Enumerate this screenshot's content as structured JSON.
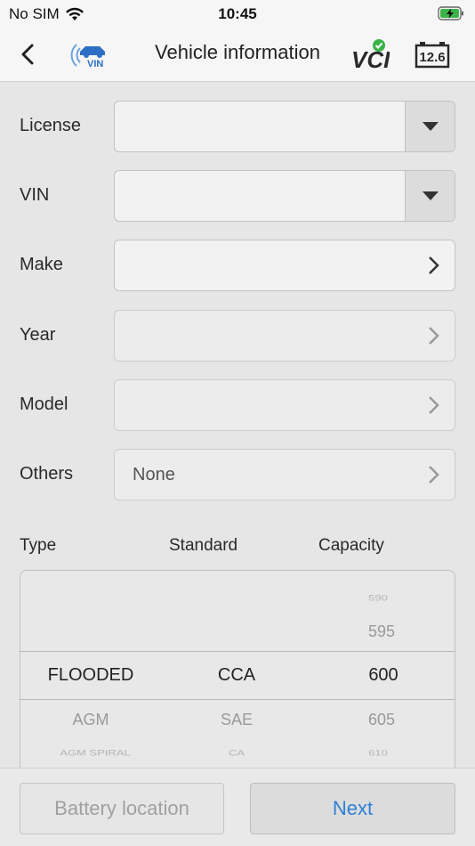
{
  "status_bar": {
    "carrier": "No SIM",
    "time": "10:45",
    "icons": [
      "wifi-icon",
      "battery-charging-icon"
    ]
  },
  "nav": {
    "title": "Vehicle information",
    "vin_logo_text": "VIN",
    "vci_text": "VCI",
    "voltage": "12.6",
    "icons": [
      "back-icon",
      "vin-scan-icon",
      "vci-connected-icon",
      "battery-voltage-icon"
    ]
  },
  "form": {
    "license": {
      "label": "License",
      "value": ""
    },
    "vin": {
      "label": "VIN",
      "value": ""
    },
    "make": {
      "label": "Make",
      "value": ""
    },
    "year": {
      "label": "Year",
      "value": ""
    },
    "model": {
      "label": "Model",
      "value": ""
    },
    "others": {
      "label": "Others",
      "value": "None"
    }
  },
  "picker": {
    "headers": {
      "type": "Type",
      "standard": "Standard",
      "capacity": "Capacity"
    },
    "type_options": [
      "FLOODED",
      "AGM",
      "AGM SPIRAL"
    ],
    "standard_options": [
      "CCA",
      "SAE",
      "CA"
    ],
    "capacity_options": [
      "590",
      "595",
      "600",
      "605",
      "610"
    ],
    "selected": {
      "type": "FLOODED",
      "standard": "CCA",
      "capacity": "600"
    }
  },
  "buttons": {
    "battery_location": "Battery location",
    "next": "Next"
  },
  "colors": {
    "accent": "#2f7fd8",
    "vci_check": "#3cb34a",
    "logo_blue": "#2d6fc4"
  }
}
